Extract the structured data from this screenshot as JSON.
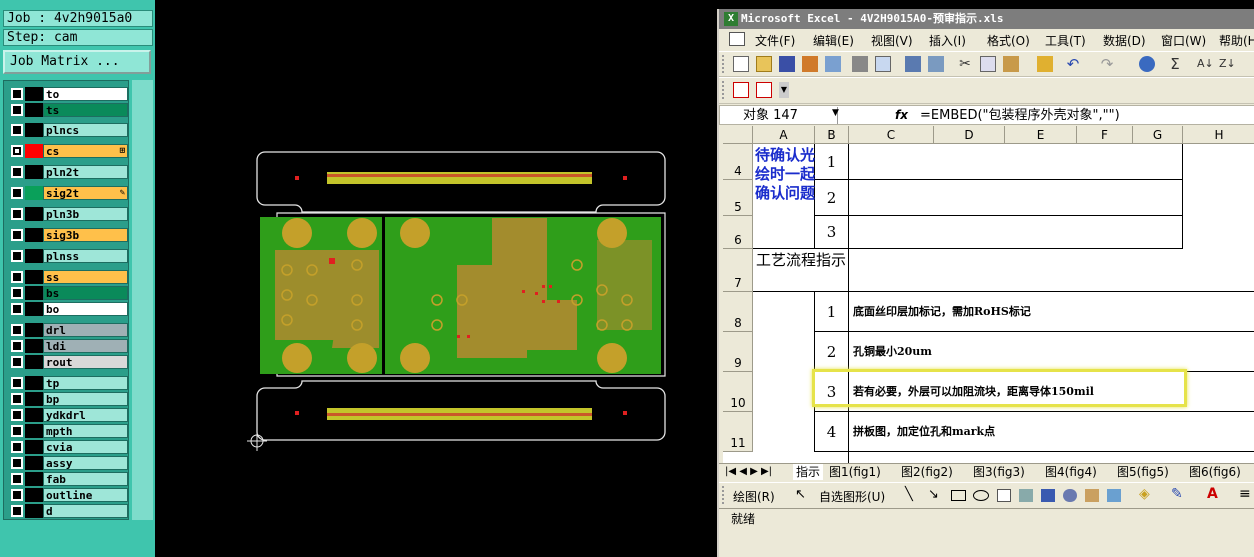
{
  "cam": {
    "job_label": "Job : 4v2h9015a0",
    "step_label": "Step: cam",
    "job_matrix_button": "Job Matrix ...",
    "layers": [
      {
        "name": "to",
        "color": "#ffffff",
        "swatch": "#000000",
        "checked": false
      },
      {
        "name": "ts",
        "color": "#0a8a5a",
        "swatch": "#000000",
        "checked": false
      },
      {
        "name": "plncs",
        "color": "#9ee6d8",
        "swatch": "#000000",
        "checked": false
      },
      {
        "name": "cs",
        "color": "#ffc04a",
        "swatch": "#ff0000",
        "checked": true,
        "mark": "⊞"
      },
      {
        "name": "pln2t",
        "color": "#9ee6d8",
        "swatch": "#000000",
        "checked": false
      },
      {
        "name": "sig2t",
        "color": "#ffc04a",
        "swatch": "#0aa05a",
        "checked": false,
        "mark": "✎"
      },
      {
        "name": "pln3b",
        "color": "#9ee6d8",
        "swatch": "#000000",
        "checked": false
      },
      {
        "name": "sig3b",
        "color": "#ffc04a",
        "swatch": "#000000",
        "checked": false
      },
      {
        "name": "plnss",
        "color": "#9ee6d8",
        "swatch": "#000000",
        "checked": false
      },
      {
        "name": "ss",
        "color": "#ffc04a",
        "swatch": "#000000",
        "checked": false
      },
      {
        "name": "bs",
        "color": "#0a8a5a",
        "swatch": "#000000",
        "checked": false
      },
      {
        "name": "bo",
        "color": "#ffffff",
        "swatch": "#000000",
        "checked": false
      },
      {
        "name": "drl",
        "color": "#9fb0b5",
        "swatch": "#000000",
        "checked": false
      },
      {
        "name": "ldi",
        "color": "#9fb0b5",
        "swatch": "#000000",
        "checked": false
      },
      {
        "name": "rout",
        "color": "#d9d9d9",
        "swatch": "#000000",
        "checked": false
      },
      {
        "name": "tp",
        "color": "#9ee6d8",
        "swatch": "#000000",
        "checked": false
      },
      {
        "name": "bp",
        "color": "#9ee6d8",
        "swatch": "#000000",
        "checked": false
      },
      {
        "name": "ydkdrl",
        "color": "#9ee6d8",
        "swatch": "#000000",
        "checked": false
      },
      {
        "name": "mpth",
        "color": "#9ee6d8",
        "swatch": "#000000",
        "checked": false
      },
      {
        "name": "cvia",
        "color": "#9ee6d8",
        "swatch": "#000000",
        "checked": false
      },
      {
        "name": "assy",
        "color": "#9ee6d8",
        "swatch": "#000000",
        "checked": false
      },
      {
        "name": "fab",
        "color": "#9ee6d8",
        "swatch": "#000000",
        "checked": false
      },
      {
        "name": "outline",
        "color": "#9ee6d8",
        "swatch": "#000000",
        "checked": false
      },
      {
        "name": "d",
        "color": "#9ee6d8",
        "swatch": "#000000",
        "checked": false
      }
    ]
  },
  "excel": {
    "title": "Microsoft Excel - 4V2H9015A0-预审指示.xls",
    "app_icon": "X",
    "menu": [
      "文件(F)",
      "编辑(E)",
      "视图(V)",
      "插入(I)",
      "格式(O)",
      "工具(T)",
      "数据(D)",
      "窗口(W)",
      "帮助(H)"
    ],
    "name_box": "对象 147",
    "fx": "fx",
    "formula": "=EMBED(\"包装程序外壳对象\",\"\")",
    "columns": [
      "A",
      "B",
      "C",
      "D",
      "E",
      "F",
      "G",
      "H"
    ],
    "rows": [
      "4",
      "5",
      "6",
      "7",
      "8",
      "9",
      "10",
      "11"
    ],
    "pending_label": "待确认光绘时一起确认问题",
    "pending_items": [
      "1",
      "2",
      "3"
    ],
    "process_label": "工艺流程指示",
    "process_items": [
      {
        "num": "1",
        "text": "底面丝印层加标记，需加RoHS标记"
      },
      {
        "num": "2",
        "text": "孔铜最小20um"
      },
      {
        "num": "3",
        "text": "若有必要，外层可以加阻流块，距离导体150mil"
      },
      {
        "num": "4",
        "text": "拼板图，加定位孔和mark点"
      }
    ],
    "sheet_nav": "|◀ ◀ ▶ ▶|",
    "sheet_tabs": [
      "指示",
      "图1(fig1)",
      "图2(fig2)",
      "图3(fig3)",
      "图4(fig4)",
      "图5(fig5)",
      "图6(fig6)"
    ],
    "draw_label": "绘图(R)",
    "autoshape_label": "自选图形(U)",
    "status": "就绪",
    "highlight_color": "#e6e34a",
    "icons": [
      "new-icon",
      "open-icon",
      "save-icon",
      "permission-icon",
      "email-icon",
      "print-icon",
      "preview-icon",
      "spell-icon",
      "research-icon",
      "cut-icon",
      "copy-icon",
      "paste-icon",
      "format-painter-icon",
      "undo-icon",
      "redo-icon",
      "hyperlink-icon",
      "autosum-icon",
      "sort-asc-icon",
      "sort-desc-icon",
      "pdf-icon",
      "pdf-email-icon"
    ]
  }
}
